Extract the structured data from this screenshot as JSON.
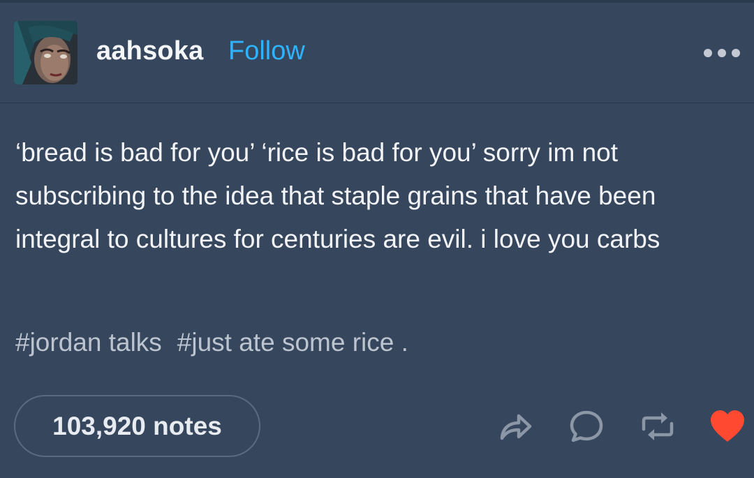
{
  "post": {
    "username": "aahsoka",
    "follow_label": "Follow",
    "more_icon": "ellipsis-icon",
    "text": "‘bread is bad for you’ ‘rice is bad for you’ sorry im not subscribing to the idea that staple grains that have been integral to cultures for centuries are evil.  i love you carbs",
    "tags": [
      "#jordan talks",
      "#just ate some rice ."
    ],
    "notes_label": "103,920 notes"
  },
  "actions": [
    {
      "icon": "share-icon"
    },
    {
      "icon": "reply-icon"
    },
    {
      "icon": "reblog-icon"
    },
    {
      "icon": "like-heart-icon",
      "color": "#ff4930"
    }
  ],
  "colors": {
    "background": "#36465d",
    "follow": "#2fb3ff",
    "icon_gray": "#8b96a6",
    "heart": "#ff4930"
  }
}
